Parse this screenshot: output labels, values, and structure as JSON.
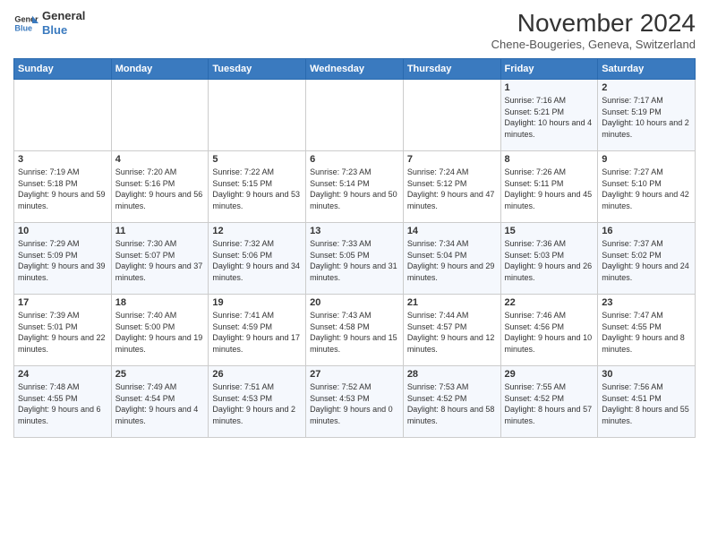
{
  "logo": {
    "line1": "General",
    "line2": "Blue"
  },
  "title": "November 2024",
  "location": "Chene-Bougeries, Geneva, Switzerland",
  "weekdays": [
    "Sunday",
    "Monday",
    "Tuesday",
    "Wednesday",
    "Thursday",
    "Friday",
    "Saturday"
  ],
  "weeks": [
    [
      {
        "day": "",
        "info": ""
      },
      {
        "day": "",
        "info": ""
      },
      {
        "day": "",
        "info": ""
      },
      {
        "day": "",
        "info": ""
      },
      {
        "day": "",
        "info": ""
      },
      {
        "day": "1",
        "info": "Sunrise: 7:16 AM\nSunset: 5:21 PM\nDaylight: 10 hours\nand 4 minutes."
      },
      {
        "day": "2",
        "info": "Sunrise: 7:17 AM\nSunset: 5:19 PM\nDaylight: 10 hours\nand 2 minutes."
      }
    ],
    [
      {
        "day": "3",
        "info": "Sunrise: 7:19 AM\nSunset: 5:18 PM\nDaylight: 9 hours\nand 59 minutes."
      },
      {
        "day": "4",
        "info": "Sunrise: 7:20 AM\nSunset: 5:16 PM\nDaylight: 9 hours\nand 56 minutes."
      },
      {
        "day": "5",
        "info": "Sunrise: 7:22 AM\nSunset: 5:15 PM\nDaylight: 9 hours\nand 53 minutes."
      },
      {
        "day": "6",
        "info": "Sunrise: 7:23 AM\nSunset: 5:14 PM\nDaylight: 9 hours\nand 50 minutes."
      },
      {
        "day": "7",
        "info": "Sunrise: 7:24 AM\nSunset: 5:12 PM\nDaylight: 9 hours\nand 47 minutes."
      },
      {
        "day": "8",
        "info": "Sunrise: 7:26 AM\nSunset: 5:11 PM\nDaylight: 9 hours\nand 45 minutes."
      },
      {
        "day": "9",
        "info": "Sunrise: 7:27 AM\nSunset: 5:10 PM\nDaylight: 9 hours\nand 42 minutes."
      }
    ],
    [
      {
        "day": "10",
        "info": "Sunrise: 7:29 AM\nSunset: 5:09 PM\nDaylight: 9 hours\nand 39 minutes."
      },
      {
        "day": "11",
        "info": "Sunrise: 7:30 AM\nSunset: 5:07 PM\nDaylight: 9 hours\nand 37 minutes."
      },
      {
        "day": "12",
        "info": "Sunrise: 7:32 AM\nSunset: 5:06 PM\nDaylight: 9 hours\nand 34 minutes."
      },
      {
        "day": "13",
        "info": "Sunrise: 7:33 AM\nSunset: 5:05 PM\nDaylight: 9 hours\nand 31 minutes."
      },
      {
        "day": "14",
        "info": "Sunrise: 7:34 AM\nSunset: 5:04 PM\nDaylight: 9 hours\nand 29 minutes."
      },
      {
        "day": "15",
        "info": "Sunrise: 7:36 AM\nSunset: 5:03 PM\nDaylight: 9 hours\nand 26 minutes."
      },
      {
        "day": "16",
        "info": "Sunrise: 7:37 AM\nSunset: 5:02 PM\nDaylight: 9 hours\nand 24 minutes."
      }
    ],
    [
      {
        "day": "17",
        "info": "Sunrise: 7:39 AM\nSunset: 5:01 PM\nDaylight: 9 hours\nand 22 minutes."
      },
      {
        "day": "18",
        "info": "Sunrise: 7:40 AM\nSunset: 5:00 PM\nDaylight: 9 hours\nand 19 minutes."
      },
      {
        "day": "19",
        "info": "Sunrise: 7:41 AM\nSunset: 4:59 PM\nDaylight: 9 hours\nand 17 minutes."
      },
      {
        "day": "20",
        "info": "Sunrise: 7:43 AM\nSunset: 4:58 PM\nDaylight: 9 hours\nand 15 minutes."
      },
      {
        "day": "21",
        "info": "Sunrise: 7:44 AM\nSunset: 4:57 PM\nDaylight: 9 hours\nand 12 minutes."
      },
      {
        "day": "22",
        "info": "Sunrise: 7:46 AM\nSunset: 4:56 PM\nDaylight: 9 hours\nand 10 minutes."
      },
      {
        "day": "23",
        "info": "Sunrise: 7:47 AM\nSunset: 4:55 PM\nDaylight: 9 hours\nand 8 minutes."
      }
    ],
    [
      {
        "day": "24",
        "info": "Sunrise: 7:48 AM\nSunset: 4:55 PM\nDaylight: 9 hours\nand 6 minutes."
      },
      {
        "day": "25",
        "info": "Sunrise: 7:49 AM\nSunset: 4:54 PM\nDaylight: 9 hours\nand 4 minutes."
      },
      {
        "day": "26",
        "info": "Sunrise: 7:51 AM\nSunset: 4:53 PM\nDaylight: 9 hours\nand 2 minutes."
      },
      {
        "day": "27",
        "info": "Sunrise: 7:52 AM\nSunset: 4:53 PM\nDaylight: 9 hours\nand 0 minutes."
      },
      {
        "day": "28",
        "info": "Sunrise: 7:53 AM\nSunset: 4:52 PM\nDaylight: 8 hours\nand 58 minutes."
      },
      {
        "day": "29",
        "info": "Sunrise: 7:55 AM\nSunset: 4:52 PM\nDaylight: 8 hours\nand 57 minutes."
      },
      {
        "day": "30",
        "info": "Sunrise: 7:56 AM\nSunset: 4:51 PM\nDaylight: 8 hours\nand 55 minutes."
      }
    ]
  ]
}
